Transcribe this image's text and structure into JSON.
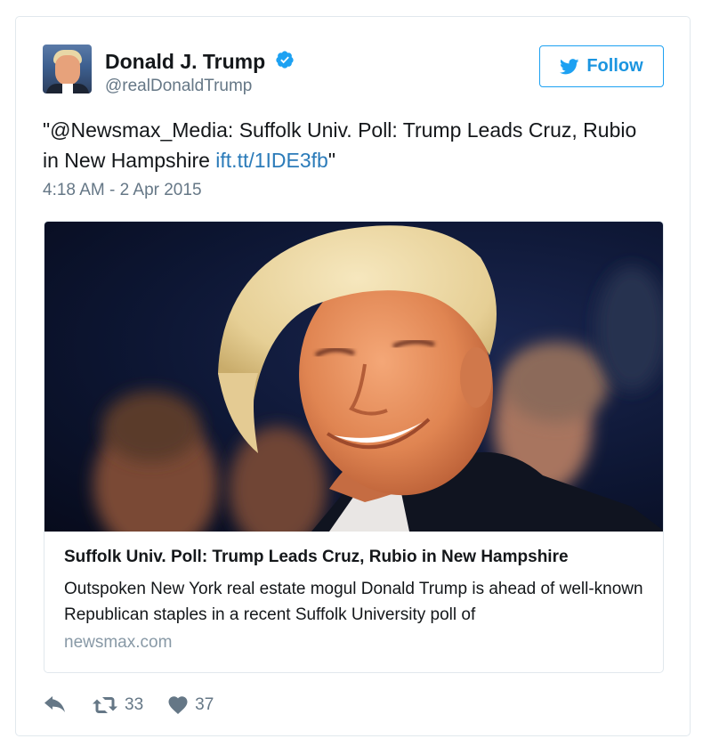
{
  "author": {
    "display_name": "Donald J. Trump",
    "handle": "@realDonaldTrump",
    "verified": true,
    "avatar_icon": "profile-photo"
  },
  "follow_button": {
    "label": "Follow",
    "icon": "twitter-bird-icon",
    "color": "#1da1f2"
  },
  "tweet": {
    "text_before_link": "\"@Newsmax_Media: Suffolk Univ. Poll: Trump Leads Cruz, Rubio in New Hampshire ",
    "link_text": "ift.tt/1IDE3fb",
    "text_after_link": "\"",
    "timestamp": "4:18 AM - 2 Apr 2015",
    "link_color": "#2b7bb9"
  },
  "link_card": {
    "image_icon": "article-photo",
    "title": "Suffolk Univ. Poll: Trump Leads Cruz, Rubio in New Hampshire",
    "description": "Outspoken New York real estate mogul Donald Trump is ahead of well-known Republican staples in a recent Suffolk University poll of",
    "domain": "newsmax.com"
  },
  "actions": {
    "reply_icon": "reply-icon",
    "retweet_icon": "retweet-icon",
    "retweet_count": "33",
    "like_icon": "heart-icon",
    "like_count": "37"
  },
  "colors": {
    "text_primary": "#14171a",
    "text_secondary": "#657786",
    "verified_badge": "#1da1f2",
    "border": "#e1e8ed"
  }
}
